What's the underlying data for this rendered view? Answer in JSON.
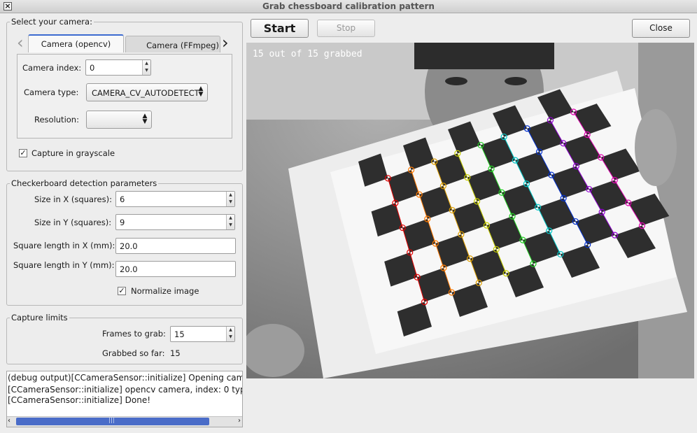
{
  "window": {
    "title": "Grab chessboard calibration pattern"
  },
  "camera_group": {
    "title": "Select your camera:",
    "tabs": [
      {
        "label": "Camera (opencv)"
      },
      {
        "label": "Camera (FFmpeg)"
      }
    ],
    "camera_index_label": "Camera index:",
    "camera_index_value": "0",
    "camera_type_label": "Camera type:",
    "camera_type_value": "CAMERA_CV_AUTODETECT",
    "resolution_label": "Resolution:",
    "resolution_value": "",
    "grayscale_label": "Capture in grayscale",
    "grayscale_checked": true
  },
  "detection_group": {
    "title": "Checkerboard detection parameters",
    "size_x_label": "Size in X (squares):",
    "size_x_value": "6",
    "size_y_label": "Size in Y (squares):",
    "size_y_value": "9",
    "square_x_label": "Square length in X (mm):",
    "square_x_value": "20.0",
    "square_y_label": "Square length in Y (mm):",
    "square_y_value": "20.0",
    "normalize_label": "Normalize image",
    "normalize_checked": true
  },
  "limits_group": {
    "title": "Capture limits",
    "frames_label": "Frames to grab:",
    "frames_value": "15",
    "grabbed_label": "Grabbed so far:",
    "grabbed_value": "15"
  },
  "log_lines": [
    "(debug output)[CCameraSensor::initialize] Opening cam",
    "[CCameraSensor::initialize] opencv camera, index: 0 typ",
    "[CCameraSensor::initialize] Done!"
  ],
  "toolbar": {
    "start_label": "Start",
    "stop_label": "Stop",
    "close_label": "Close"
  },
  "view": {
    "overlay_text": "15 out of 15 grabbed"
  },
  "colors": {
    "accent": "#3c6bd0",
    "scrollbar": "#4a6cc8"
  },
  "icons": {
    "check": "✓",
    "left": "‹",
    "right": "›",
    "updown": "⇕"
  }
}
